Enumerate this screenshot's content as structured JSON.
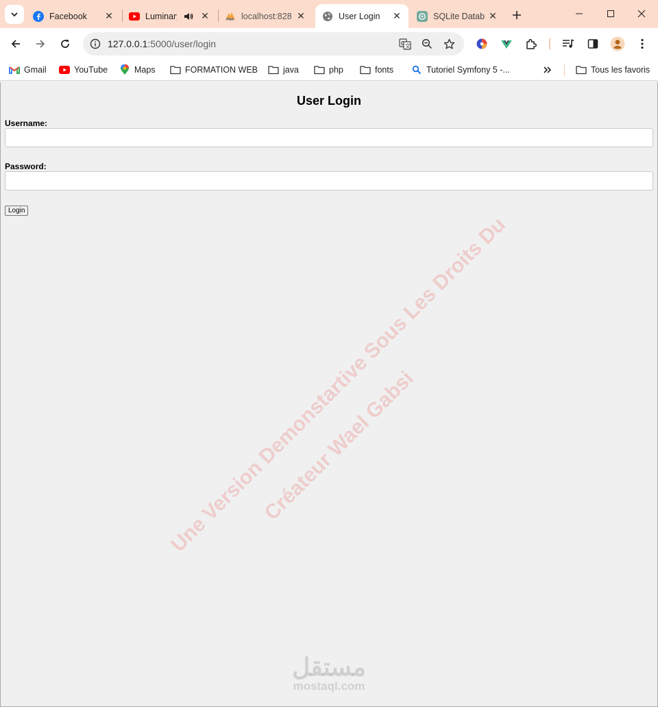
{
  "browser": {
    "tabs": [
      {
        "title": "Facebook",
        "icon": "facebook-icon"
      },
      {
        "title": "Luminary",
        "icon": "youtube-icon",
        "audio": true
      },
      {
        "title": "localhost:828",
        "icon": "phpmyadmin-icon"
      },
      {
        "title": "User Login",
        "icon": "globe-icon",
        "active": true
      },
      {
        "title": "SQLite Datab",
        "icon": "chatgpt-icon"
      }
    ],
    "url_host": "127.0.0.1",
    "url_rest": ":5000/user/login",
    "bookmarks": [
      {
        "label": "Gmail",
        "icon": "gmail-icon"
      },
      {
        "label": "YouTube",
        "icon": "youtube-icon"
      },
      {
        "label": "Maps",
        "icon": "maps-icon"
      },
      {
        "label": "FORMATION WEB",
        "icon": "folder-icon"
      },
      {
        "label": "java",
        "icon": "folder-icon"
      },
      {
        "label": "php",
        "icon": "folder-icon"
      },
      {
        "label": "fonts",
        "icon": "folder-icon"
      },
      {
        "label": "Tutoriel Symfony 5 -...",
        "icon": "search-icon"
      }
    ],
    "all_bookmarks": "Tous les favoris",
    "accent": "#fcdccc"
  },
  "page": {
    "title": "User Login",
    "username_label": "Username:",
    "username_value": "",
    "password_label": "Password:",
    "password_value": "",
    "login_button": "Login"
  },
  "watermark": {
    "line1": "Une Version Demonstartive Sous Les Droits Du",
    "line2": "Créateur Wael Gabsi",
    "brand_ar": "مستقل",
    "brand_en": "mostaql.com"
  }
}
